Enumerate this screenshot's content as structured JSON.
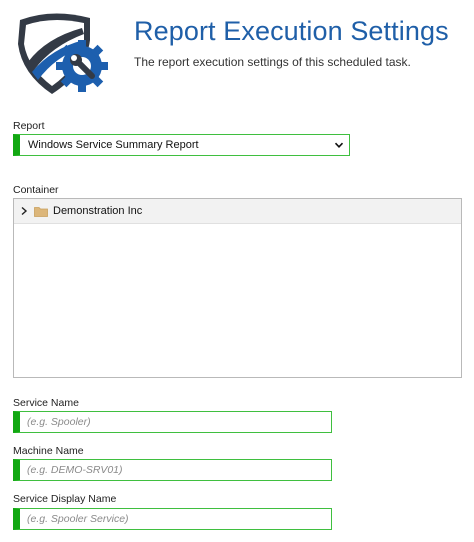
{
  "header": {
    "title": "Report Execution Settings",
    "subtitle": "The report execution settings of this scheduled task.",
    "logo_icon": "shield-gear-wrench-icon"
  },
  "report": {
    "label": "Report",
    "selected": "Windows Service Summary Report"
  },
  "container": {
    "label": "Container",
    "items": [
      {
        "label": "Demonstration Inc",
        "icon": "folder-icon",
        "expanded": false
      }
    ]
  },
  "fields": {
    "service_name": {
      "label": "Service Name",
      "placeholder": "(e.g. Spooler)"
    },
    "machine_name": {
      "label": "Machine Name",
      "placeholder": "(e.g. DEMO-SRV01)"
    },
    "service_display_name": {
      "label": "Service Display Name",
      "placeholder": "(e.g. Spooler Service)"
    }
  },
  "colors": {
    "title": "#1f5fa8",
    "required_accent": "#12a812",
    "logo_dark": "#333a45",
    "logo_blue": "#1d5fae"
  }
}
